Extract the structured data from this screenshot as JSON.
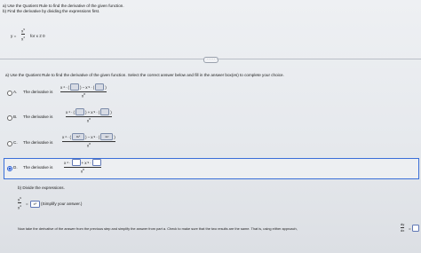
{
  "instructions": {
    "a": "a) Use the Quotient Rule to find the derivative of the given function.",
    "b": "b) Find the derivative by dividing the expressions first."
  },
  "function": {
    "y_label": "y =",
    "numerator": "x",
    "numerator_exp": "9",
    "denominator": "x",
    "denominator_exp": "4",
    "condition": "for x ≠ 0"
  },
  "pager_label": "· · · · ·",
  "part_a_prompt": "a) Use the Quotient Rule to find the derivative of the given function. Select the correct answer below and fill in the answer box(es) to complete your choice.",
  "options": [
    {
      "letter": "A.",
      "text": "The derivative is",
      "num_pre": "x",
      "num_exp": "4",
      "den": "x",
      "den_exp": "8",
      "selected": false
    },
    {
      "letter": "B.",
      "text": "The derivative is",
      "num_pre": "x",
      "num_exp": "4",
      "den": "x",
      "den_exp": "8",
      "selected": false
    },
    {
      "letter": "C.",
      "text": "The derivative is",
      "num_pre": "x",
      "num_exp": "4",
      "den": "x",
      "den_exp": "8",
      "box1": "9x⁸",
      "box2": "4x³",
      "selected": false
    },
    {
      "letter": "D.",
      "text": "The derivative is",
      "num_pre": "x",
      "num_exp": "4",
      "den": "x",
      "den_exp": "8",
      "selected": true
    }
  ],
  "part_b": {
    "label": "b) Divide the expressions.",
    "frac_num": "x",
    "frac_num_exp": "9",
    "frac_den": "x",
    "frac_den_exp": "4",
    "equals": "=",
    "answer_value": "x⁵",
    "hint": "(Simplify your answer.)",
    "final_instruction": "Now take the derivative of the answer from the previous step and simplify the answer from part a. Check to make sure that the two results are the same. That is, using either approach,",
    "dy": "dy",
    "dx": "dx",
    "final_equals": "="
  }
}
